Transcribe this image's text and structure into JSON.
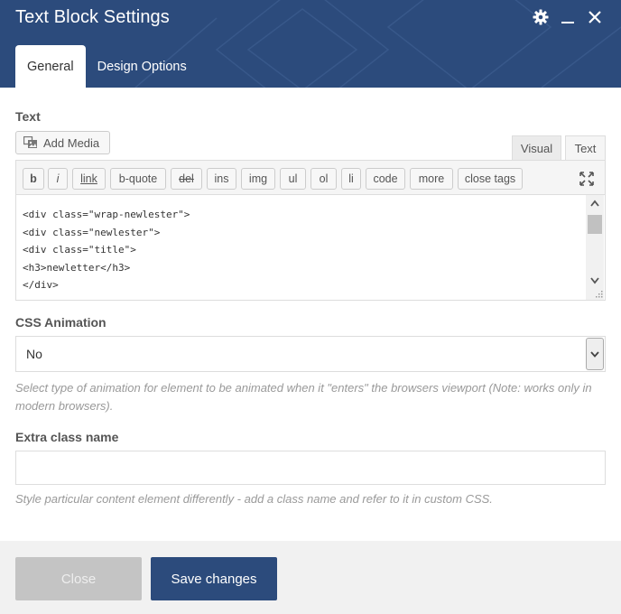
{
  "header": {
    "title": "Text Block Settings",
    "icons": [
      "gear-icon",
      "minimize-icon",
      "close-icon"
    ],
    "bg_color": "#2c4b7c"
  },
  "tabs": [
    {
      "label": "General",
      "active": true
    },
    {
      "label": "Design Options",
      "active": false
    }
  ],
  "text_section": {
    "label": "Text",
    "add_media_label": "Add Media",
    "mode_tabs": {
      "visual": "Visual",
      "text": "Text"
    },
    "quicktags": [
      "b",
      "i",
      "link",
      "b-quote",
      "del",
      "ins",
      "img",
      "ul",
      "ol",
      "li",
      "code",
      "more",
      "close tags"
    ],
    "code_lines": [
      "<div class=\"wrap-newlester\">",
      "<div class=\"newlester\">",
      "<div class=\"title\">",
      "<h3>newletter</h3>",
      "</div>"
    ]
  },
  "css_animation": {
    "label": "CSS Animation",
    "selected": "No",
    "help": "Select type of animation for element to be animated when it \"enters\" the browsers viewport (Note: works only in modern browsers)."
  },
  "extra_class": {
    "label": "Extra class name",
    "value": "",
    "placeholder": "",
    "help": "Style particular content element differently - add a class name and refer to it in custom CSS."
  },
  "footer": {
    "close_label": "Close",
    "save_label": "Save changes"
  }
}
